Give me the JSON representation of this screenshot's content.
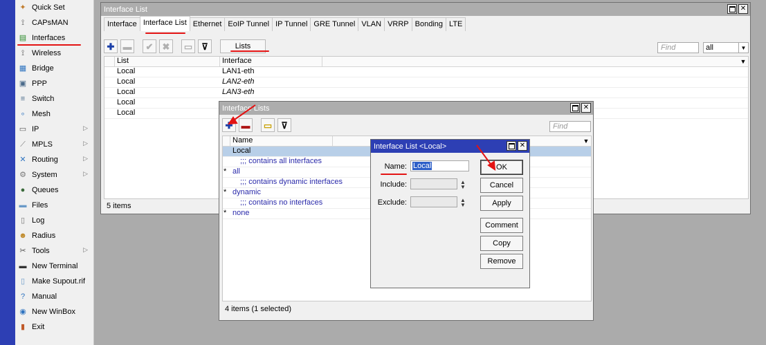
{
  "menu": {
    "items": [
      {
        "label": "Quick Set",
        "icon": "quick-set-icon",
        "glyph": "✦",
        "color": "#c07a2a",
        "submenu": false
      },
      {
        "label": "CAPsMAN",
        "icon": "capsman-icon",
        "glyph": "⟟",
        "color": "#4a4a4a",
        "submenu": false
      },
      {
        "label": "Interfaces",
        "icon": "interfaces-icon",
        "glyph": "▤",
        "color": "#2a8a2a",
        "submenu": false
      },
      {
        "label": "Wireless",
        "icon": "wireless-icon",
        "glyph": "⟟",
        "color": "#4a4a4a",
        "submenu": false
      },
      {
        "label": "Bridge",
        "icon": "bridge-icon",
        "glyph": "▦",
        "color": "#2f74c0",
        "submenu": false
      },
      {
        "label": "PPP",
        "icon": "ppp-icon",
        "glyph": "▣",
        "color": "#4a6a8a",
        "submenu": false
      },
      {
        "label": "Switch",
        "icon": "switch-icon",
        "glyph": "≡",
        "color": "#4a6a8a",
        "submenu": false
      },
      {
        "label": "Mesh",
        "icon": "mesh-icon",
        "glyph": "∘",
        "color": "#2f74c0",
        "submenu": false
      },
      {
        "label": "IP",
        "icon": "ip-icon",
        "glyph": "▭",
        "color": "#555",
        "submenu": true
      },
      {
        "label": "MPLS",
        "icon": "mpls-icon",
        "glyph": "⟋",
        "color": "#777",
        "submenu": true
      },
      {
        "label": "Routing",
        "icon": "routing-icon",
        "glyph": "✕",
        "color": "#2f74c0",
        "submenu": true
      },
      {
        "label": "System",
        "icon": "system-icon",
        "glyph": "⚙",
        "color": "#777",
        "submenu": true
      },
      {
        "label": "Queues",
        "icon": "queues-icon",
        "glyph": "●",
        "color": "#3a6a3a",
        "submenu": false
      },
      {
        "label": "Files",
        "icon": "files-icon",
        "glyph": "▬",
        "color": "#6a9ac8",
        "submenu": false
      },
      {
        "label": "Log",
        "icon": "log-icon",
        "glyph": "▯",
        "color": "#777",
        "submenu": false
      },
      {
        "label": "Radius",
        "icon": "radius-icon",
        "glyph": "☻",
        "color": "#c08a2a",
        "submenu": false
      },
      {
        "label": "Tools",
        "icon": "tools-icon",
        "glyph": "✂",
        "color": "#555",
        "submenu": true
      },
      {
        "label": "New Terminal",
        "icon": "terminal-icon",
        "glyph": "▬",
        "color": "#333",
        "submenu": false
      },
      {
        "label": "Make Supout.rif",
        "icon": "supout-icon",
        "glyph": "▯",
        "color": "#6a9ac8",
        "submenu": false
      },
      {
        "label": "Manual",
        "icon": "manual-icon",
        "glyph": "?",
        "color": "#2f74c0",
        "submenu": false
      },
      {
        "label": "New WinBox",
        "icon": "winbox-icon",
        "glyph": "◉",
        "color": "#2f74c0",
        "submenu": false
      },
      {
        "label": "Exit",
        "icon": "exit-icon",
        "glyph": "▮",
        "color": "#c05a2a",
        "submenu": false
      }
    ]
  },
  "main_window": {
    "title": "Interface List",
    "tabs": [
      "Interface",
      "Interface List",
      "Ethernet",
      "EoIP Tunnel",
      "IP Tunnel",
      "GRE Tunnel",
      "VLAN",
      "VRRP",
      "Bonding",
      "LTE"
    ],
    "active_tab": "Interface List",
    "lists_button": "Lists",
    "find_placeholder": "Find",
    "filter_value": "all",
    "columns": [
      "List",
      "Interface"
    ],
    "rows": [
      {
        "list": "Local",
        "interface": "LAN1-eth",
        "italic": false
      },
      {
        "list": "Local",
        "interface": "LAN2-eth",
        "italic": true
      },
      {
        "list": "Local",
        "interface": "LAN3-eth",
        "italic": true
      },
      {
        "list": "Local",
        "interface": "",
        "italic": false
      },
      {
        "list": "Local",
        "interface": "",
        "italic": false
      }
    ],
    "status": "5 items"
  },
  "lists_window": {
    "title": "Interface Lists",
    "find_placeholder": "Find",
    "columns": [
      "Name"
    ],
    "rows": [
      {
        "flag": "",
        "name": "Local",
        "comment": false,
        "selected": true
      },
      {
        "flag": "",
        "name": ";;; contains all interfaces",
        "comment": true,
        "selected": false
      },
      {
        "flag": "*",
        "name": "all",
        "comment": false,
        "selected": false
      },
      {
        "flag": "",
        "name": ";;; contains dynamic interfaces",
        "comment": true,
        "selected": false
      },
      {
        "flag": "*",
        "name": "dynamic",
        "comment": false,
        "selected": false
      },
      {
        "flag": "",
        "name": ";;; contains no interfaces",
        "comment": true,
        "selected": false
      },
      {
        "flag": "*",
        "name": "none",
        "comment": false,
        "selected": false
      }
    ],
    "status": "4 items (1 selected)"
  },
  "dialog": {
    "title": "Interface List <Local>",
    "name_label": "Name:",
    "name_value": "Local",
    "include_label": "Include:",
    "exclude_label": "Exclude:",
    "buttons": {
      "ok": "OK",
      "cancel": "Cancel",
      "apply": "Apply",
      "comment": "Comment",
      "copy": "Copy",
      "remove": "Remove"
    }
  },
  "colors": {
    "brand_bar": "#2d3fb4",
    "annotation_red": "#e31313",
    "selection": "#b8cfe8",
    "comment_text": "#2a2aaa"
  }
}
